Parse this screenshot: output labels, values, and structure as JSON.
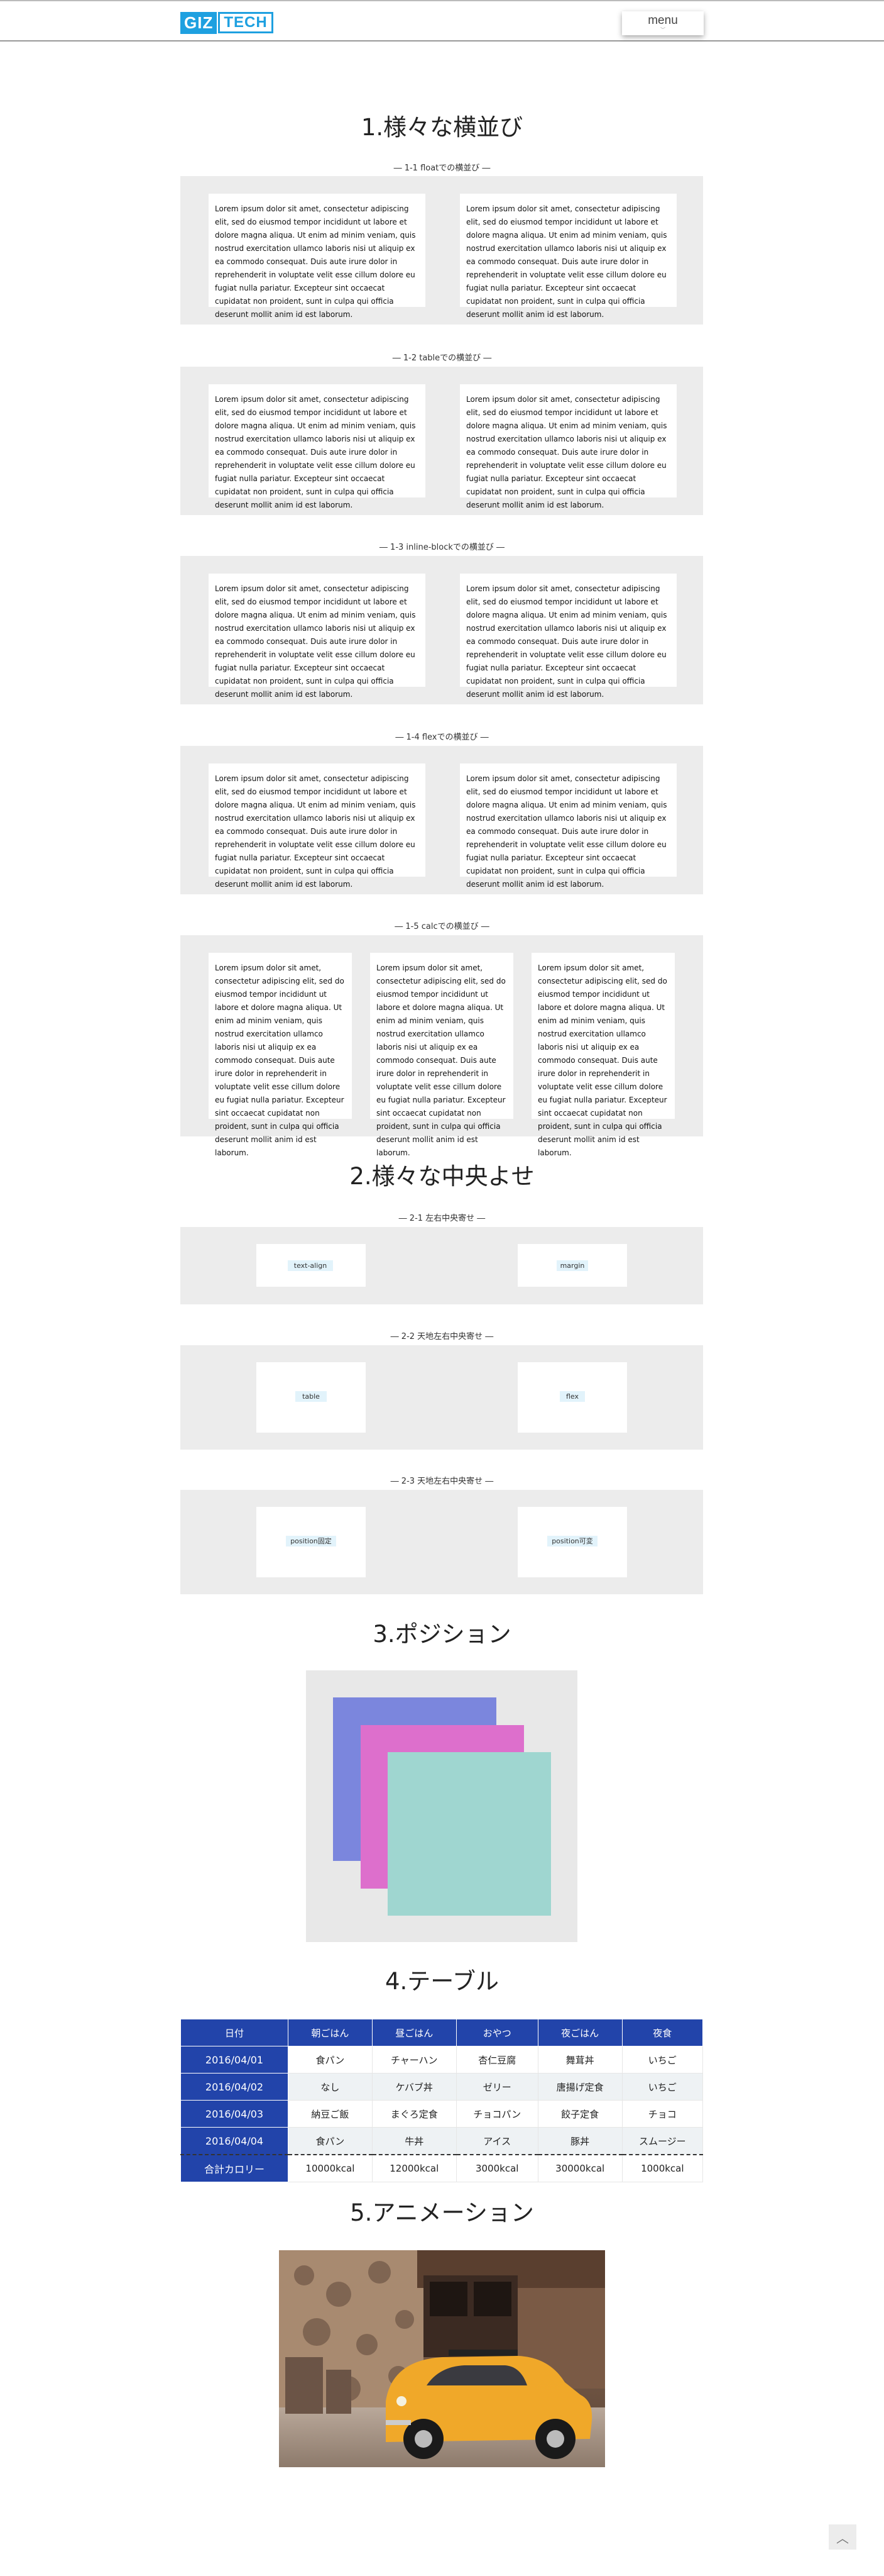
{
  "header": {
    "logo_giz": "GIZ",
    "logo_tech": "TECH",
    "menu_label": "menu",
    "menu_chevron": "﹀"
  },
  "lorem": "Lorem ipsum dolor sit amet, consectetur adipiscing elit, sed do eiusmod tempor incididunt ut labore et dolore magna aliqua. Ut enim ad minim veniam, quis nostrud exercitation ullamco laboris nisi ut aliquip ex ea commodo consequat. Duis aute irure dolor in reprehenderit in voluptate velit esse cillum dolore eu fugiat nulla pariatur. Excepteur sint occaecat cupidatat non proident, sunt in culpa qui officia deserunt mollit anim id est laborum.",
  "section1": {
    "title": "1.様々な横並び",
    "sub1": "― 1-1 floatでの横並び ―",
    "sub2": "― 1-2 tableでの横並び ―",
    "sub3": "― 1-3 inline-blockでの横並び ―",
    "sub4": "― 1-4 flexでの横並び ―",
    "sub5": "― 1-5 calcでの横並び ―"
  },
  "section2": {
    "title": "2.様々な中央よせ",
    "sub1": "― 2-1 左右中央寄せ ―",
    "sub2": "― 2-2 天地左右中央寄せ ―",
    "sub3": "― 2-3 天地左右中央寄せ ―",
    "tag_text_align": "text-align",
    "tag_margin": "margin",
    "tag_table": "table",
    "tag_flex": "flex",
    "tag_pos_fixed": "position固定",
    "tag_pos_var": "position可変"
  },
  "section3": {
    "title": "3.ポジション",
    "colors": {
      "back": "#7b86dd",
      "middle": "#dd6fcc",
      "front": "#9fd6d0",
      "box": "#e8e8e8"
    }
  },
  "section4": {
    "title": "4.テーブル",
    "headers": [
      "日付",
      "朝ごはん",
      "昼ごはん",
      "おやつ",
      "夜ごはん",
      "夜食"
    ],
    "rows": [
      [
        "2016/04/01",
        "食パン",
        "チャーハン",
        "杏仁豆腐",
        "舞茸丼",
        "いちご"
      ],
      [
        "2016/04/02",
        "なし",
        "ケバブ丼",
        "ゼリー",
        "唐揚げ定食",
        "いちご"
      ],
      [
        "2016/04/03",
        "納豆ご飯",
        "まぐろ定食",
        "チョコパン",
        "餃子定食",
        "チョコ"
      ],
      [
        "2016/04/04",
        "食パン",
        "牛丼",
        "アイス",
        "豚丼",
        "スムージー"
      ]
    ],
    "total": [
      "合計カロリー",
      "10000kcal",
      "12000kcal",
      "3000kcal",
      "30000kcal",
      "1000kcal"
    ]
  },
  "section5": {
    "title": "5.アニメーション"
  },
  "to_top": "︿",
  "colors": {
    "brand": "#1ea0e0",
    "table_head": "#2244aa",
    "panel": "#ececec"
  }
}
